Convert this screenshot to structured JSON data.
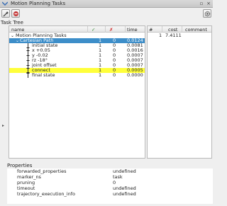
{
  "window": {
    "title": "Motion Planning Tasks"
  },
  "task_tree": {
    "label": "Task Tree",
    "columns": {
      "name": "name",
      "success": "✓",
      "fail": "✗",
      "time": "time"
    },
    "rows": [
      {
        "name": "Motion Planning Tasks",
        "success": "",
        "fail": "",
        "time": ""
      },
      {
        "name": "Cartesian Path",
        "success": "1",
        "fail": "0",
        "time": "0.0124"
      },
      {
        "name": "initial state",
        "success": "1",
        "fail": "0",
        "time": "0.0081"
      },
      {
        "name": "x +0.05",
        "success": "1",
        "fail": "0",
        "time": "0.0016"
      },
      {
        "name": "y -0.02",
        "success": "1",
        "fail": "0",
        "time": "0.0007"
      },
      {
        "name": "rz -18°",
        "success": "1",
        "fail": "0",
        "time": "0.0007"
      },
      {
        "name": "joint offset",
        "success": "1",
        "fail": "0",
        "time": "0.0007"
      },
      {
        "name": "connect",
        "success": "1",
        "fail": "0",
        "time": "0.0005"
      },
      {
        "name": "final state",
        "success": "1",
        "fail": "0",
        "time": "0.0000"
      }
    ]
  },
  "solutions": {
    "columns": {
      "id": "#",
      "cost": "cost",
      "comment": "comment"
    },
    "rows": [
      {
        "id": "1",
        "cost": "7.4111",
        "comment": ""
      }
    ]
  },
  "properties": {
    "label": "Properties",
    "rows": [
      {
        "key": "forwarded_properties",
        "value": "undefined"
      },
      {
        "key": "marker_ns",
        "value": "task"
      },
      {
        "key": "pruning",
        "value": "0"
      },
      {
        "key": "timeout",
        "value": "undefined"
      },
      {
        "key": "trajectory_execution_info",
        "value": "undefined"
      }
    ]
  },
  "colors": {
    "selected": "#3d8ec9",
    "highlight": "#ffff3a",
    "success": "#2e8b2e",
    "fail": "#d02020"
  }
}
